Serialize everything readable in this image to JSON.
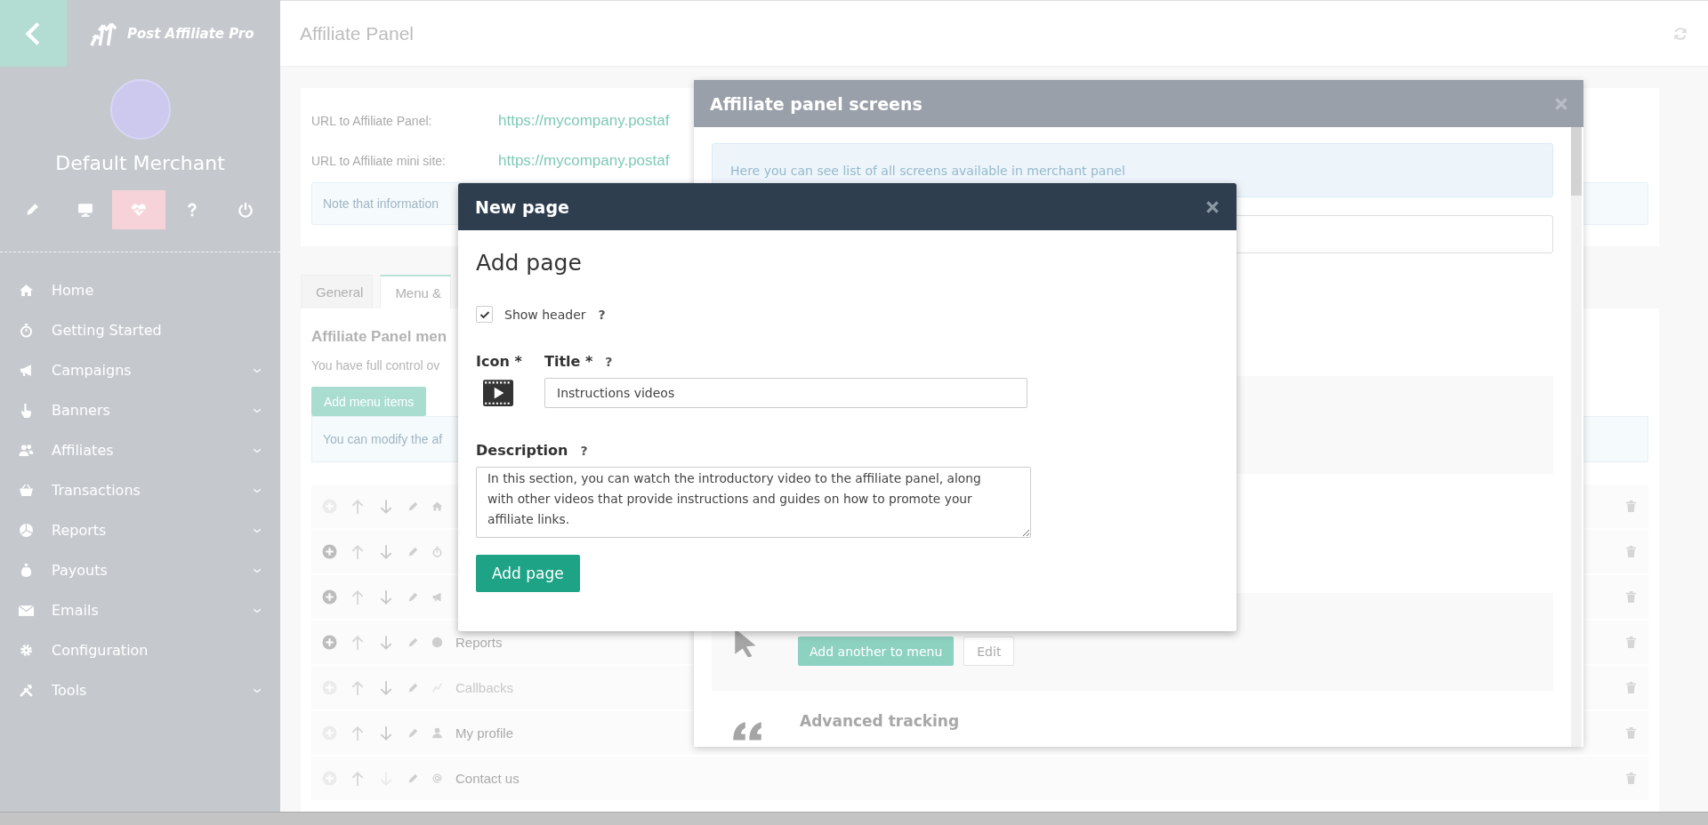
{
  "sidebar": {
    "brand": "Post Affiliate Pro",
    "user_name": "Default Merchant",
    "quick_actions": [
      {
        "selected": false
      },
      {
        "selected": false
      },
      {
        "selected": true
      },
      {
        "selected": false
      },
      {
        "selected": false
      }
    ],
    "menu": [
      {
        "label": "Home",
        "expandable": false
      },
      {
        "label": "Getting Started",
        "expandable": false
      },
      {
        "label": "Campaigns",
        "expandable": true
      },
      {
        "label": "Banners",
        "expandable": true
      },
      {
        "label": "Affiliates",
        "expandable": true
      },
      {
        "label": "Transactions",
        "expandable": true
      },
      {
        "label": "Reports",
        "expandable": true
      },
      {
        "label": "Payouts",
        "expandable": true
      },
      {
        "label": "Emails",
        "expandable": true
      },
      {
        "label": "Configuration",
        "expandable": false
      },
      {
        "label": "Tools",
        "expandable": true
      }
    ]
  },
  "main": {
    "title": "Affiliate Panel",
    "url_rows": [
      {
        "label": "URL to Affiliate Panel:",
        "value": "https://mycompany.postaf"
      },
      {
        "label": "URL to Affiliate mini site:",
        "value": "https://mycompany.postaf"
      }
    ],
    "note": "Note that information",
    "tabs": [
      {
        "label": "General",
        "selected": false
      },
      {
        "label": "Menu &",
        "selected": true
      }
    ],
    "menu_section": {
      "heading": "Affiliate Panel men",
      "description": "You have full control ov",
      "add_button": "Add menu items",
      "info": "You can modify the af"
    },
    "rows": [
      {
        "label": null,
        "can_add": false,
        "can_move_down": true,
        "disabled": false
      },
      {
        "label": null,
        "can_add": true,
        "can_move_down": true,
        "disabled": false
      },
      {
        "label": null,
        "can_add": true,
        "can_move_down": true,
        "disabled": false
      },
      {
        "label": "Reports",
        "can_add": true,
        "can_move_down": true,
        "disabled": false
      },
      {
        "label": "Callbacks",
        "can_add": false,
        "can_move_down": true,
        "disabled": true
      },
      {
        "label": "My profile",
        "can_add": false,
        "can_move_down": true,
        "disabled": false
      },
      {
        "label": "Contact us",
        "can_add": false,
        "can_move_down": false,
        "disabled": false
      }
    ]
  },
  "screens_modal": {
    "title": "Affiliate panel screens",
    "info": "Here you can see list of all screens available in merchant panel",
    "add_button": "Add another to menu",
    "edit_button": "Edit",
    "next_heading": "Advanced tracking"
  },
  "new_page": {
    "title": "New page",
    "heading": "Add page",
    "help_mark": "?",
    "show_header": {
      "label": "Show header",
      "checked": true
    },
    "icon_label": "Icon *",
    "title_label": "Title *",
    "title_value": "Instructions videos",
    "description_label": "Description",
    "description_value": "In this section, you can watch the introductory video to the affiliate panel, along with other videos that provide instructions and guides on how to promote your affiliate links.",
    "submit": "Add page"
  }
}
